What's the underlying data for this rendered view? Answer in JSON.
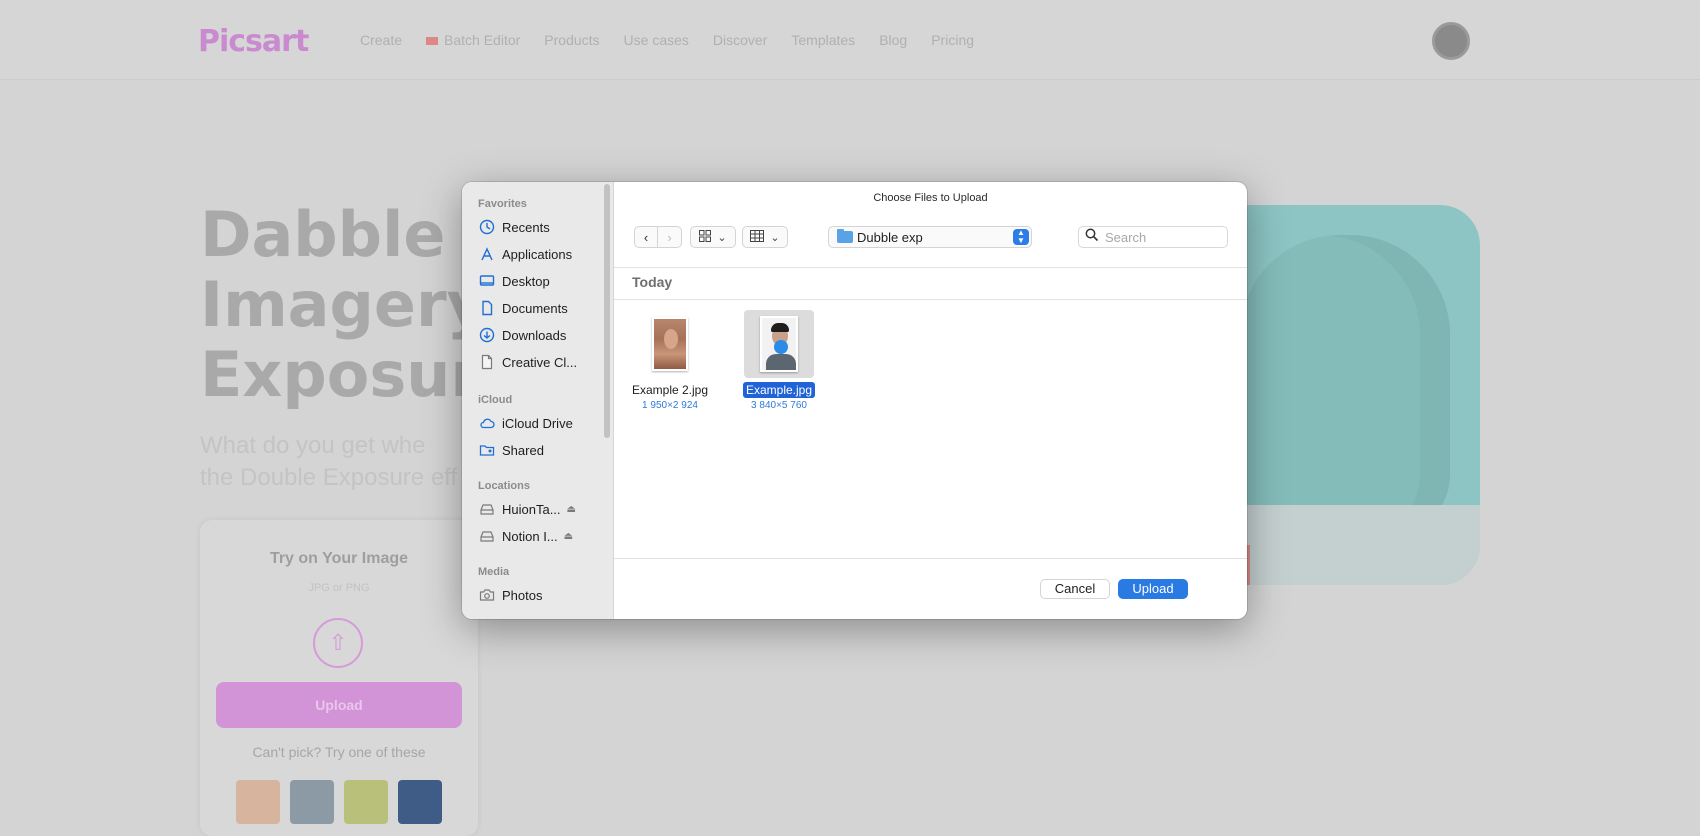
{
  "background": {
    "logo": "Picsart",
    "nav": [
      "Create",
      "Batch Editor",
      "Products",
      "Use cases",
      "Discover",
      "Templates",
      "Blog",
      "Pricing"
    ],
    "hero_title_lines": [
      "Dabble in",
      "Imagery w",
      "Exposure"
    ],
    "hero_sub_lines": [
      "What do you get whe",
      "the Double Exposure eff"
    ],
    "try_card": {
      "title": "Try on Your Image",
      "format": "JPG or PNG",
      "upload_label": "Upload",
      "cant_pick": "Can't pick? Try one of these"
    }
  },
  "dialog": {
    "title": "Choose Files to Upload",
    "sidebar": {
      "sections": [
        {
          "label": "Favorites",
          "items": [
            {
              "label": "Recents",
              "icon": "clock-icon"
            },
            {
              "label": "Applications",
              "icon": "applications-icon"
            },
            {
              "label": "Desktop",
              "icon": "desktop-icon"
            },
            {
              "label": "Documents",
              "icon": "document-icon"
            },
            {
              "label": "Downloads",
              "icon": "download-icon"
            },
            {
              "label": "Creative Cl...",
              "icon": "file-icon"
            }
          ]
        },
        {
          "label": "iCloud",
          "items": [
            {
              "label": "iCloud Drive",
              "icon": "cloud-icon"
            },
            {
              "label": "Shared",
              "icon": "shared-folder-icon"
            }
          ]
        },
        {
          "label": "Locations",
          "items": [
            {
              "label": "HuionTa...",
              "icon": "drive-icon"
            },
            {
              "label": "Notion I...",
              "icon": "drive-icon"
            }
          ]
        },
        {
          "label": "Media",
          "items": [
            {
              "label": "Photos",
              "icon": "camera-icon"
            }
          ]
        }
      ]
    },
    "toolbar": {
      "current_folder": "Dubble exp",
      "search_placeholder": "Search"
    },
    "group_label": "Today",
    "files": [
      {
        "name": "Example 2.jpg",
        "dims": "1 950×2 924",
        "selected": false
      },
      {
        "name": "Example.jpg",
        "dims": "3 840×5 760",
        "selected": true
      }
    ],
    "cancel_label": "Cancel",
    "upload_label": "Upload"
  },
  "colors": {
    "accent": "#2a7ae4",
    "selection": "#1f63d6",
    "brand": "#c98ad0"
  }
}
